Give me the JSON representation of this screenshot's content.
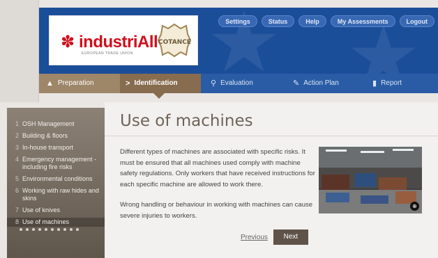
{
  "header": {
    "logo_industriall": "industriAll",
    "logo_industriall_sub": "EUROPEAN TRADE UNION",
    "logo_cotance": "COTANCE",
    "topnav": [
      "Settings",
      "Status",
      "Help",
      "My Assessments",
      "Logout"
    ]
  },
  "steps": [
    {
      "label": "Preparation",
      "icon": "warning-triangle-icon"
    },
    {
      "label": "Identification",
      "icon": "chevron-icon"
    },
    {
      "label": "Evaluation",
      "icon": "search-icon"
    },
    {
      "label": "Action Plan",
      "icon": "pencil-icon"
    },
    {
      "label": "Report",
      "icon": "document-icon"
    }
  ],
  "sidebar": {
    "items": [
      {
        "num": "1",
        "label": "OSH Management"
      },
      {
        "num": "2",
        "label": "Building & floors"
      },
      {
        "num": "3",
        "label": "In-house transport"
      },
      {
        "num": "4",
        "label": "Emergency management - including fire risks"
      },
      {
        "num": "5",
        "label": "Environmental conditions"
      },
      {
        "num": "6",
        "label": "Working with raw hides and skins"
      },
      {
        "num": "7",
        "label": "Use of knives"
      },
      {
        "num": "8",
        "label": "Use of machines"
      }
    ],
    "dot_count": 10
  },
  "main": {
    "title": "Use of machines",
    "paragraph1": "Different types of machines are associated with specific risks. It must be ensured that all machines used comply with machine safety regulations. Only workers that have received instructions for each specific machine are allowed to work there.",
    "paragraph2": "Wrong handling or behaviour in working with machines can cause severe injuries to workers.",
    "previous_label": "Previous",
    "next_label": "Next"
  },
  "colors": {
    "header_blue": "#1b4e99",
    "step_active": "#876c4f",
    "industriall_red": "#d0101d"
  }
}
